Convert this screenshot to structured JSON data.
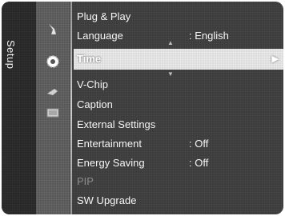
{
  "menu": {
    "section_title": "Setup",
    "icons": [
      "picture-icon",
      "setup-gear-icon",
      "sound-icon",
      "input-icon"
    ],
    "items": [
      {
        "label": "Plug & Play",
        "value": ""
      },
      {
        "label": "Language",
        "value": ": English"
      },
      {
        "label": "Time",
        "value": "",
        "selected": true,
        "arrow": "▶"
      },
      {
        "label": "V-Chip",
        "value": ""
      },
      {
        "label": "Caption",
        "value": ""
      },
      {
        "label": "External Settings",
        "value": ""
      },
      {
        "label": "Entertainment",
        "value": ": Off"
      },
      {
        "label": "Energy Saving",
        "value": ": Off"
      },
      {
        "label": "PIP",
        "value": "",
        "disabled": true
      },
      {
        "label": "SW Upgrade",
        "value": ""
      }
    ]
  },
  "colors": {
    "background": "#3a3a3a",
    "highlight": "#d9d9d9",
    "text": "#f5f5f5",
    "disabled_text": "#8a8a8a"
  }
}
